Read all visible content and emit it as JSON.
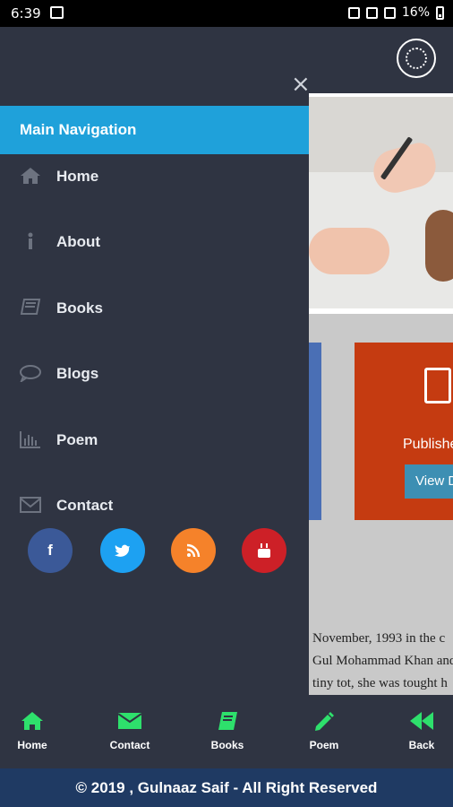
{
  "status_bar": {
    "time": "6:39",
    "battery": "16%"
  },
  "drawer": {
    "close": "×",
    "title": "Main Navigation",
    "items": [
      {
        "label": "Home",
        "icon": "home-icon"
      },
      {
        "label": "About",
        "icon": "info-icon"
      },
      {
        "label": "Books",
        "icon": "book-icon"
      },
      {
        "label": "Blogs",
        "icon": "comment-icon"
      },
      {
        "label": "Poem",
        "icon": "bar-chart-icon"
      },
      {
        "label": "Contact",
        "icon": "envelope-icon"
      }
    ],
    "social": [
      {
        "glyph": "f",
        "icon": "facebook-icon",
        "color": "#3b5998"
      },
      {
        "glyph": "t",
        "icon": "twitter-icon",
        "color": "#1da1f2"
      },
      {
        "glyph": "rss",
        "icon": "rss-icon",
        "color": "#f5822a"
      },
      {
        "glyph": "yt",
        "icon": "youtube-icon",
        "color": "#cd2027"
      }
    ]
  },
  "background": {
    "card_label": "Publishe",
    "card_button": "View D",
    "paragraph": [
      "November, 1993 in the c",
      "Gul Mohammad Khan and",
      "tiny tot, she was tought h"
    ]
  },
  "bottom_nav": [
    {
      "label": "Home",
      "icon": "home-icon"
    },
    {
      "label": "Contact",
      "icon": "envelope-icon"
    },
    {
      "label": "Books",
      "icon": "book-icon"
    },
    {
      "label": "Poem",
      "icon": "pencil-icon"
    },
    {
      "label": "Back",
      "icon": "back-icon"
    }
  ],
  "footer": "© 2019 , Gulnaaz Saif - All Right Reserved",
  "colors": {
    "accent": "#1fa1da",
    "bottom_icons": "#2ee06c",
    "footer": "#1f3a63"
  }
}
